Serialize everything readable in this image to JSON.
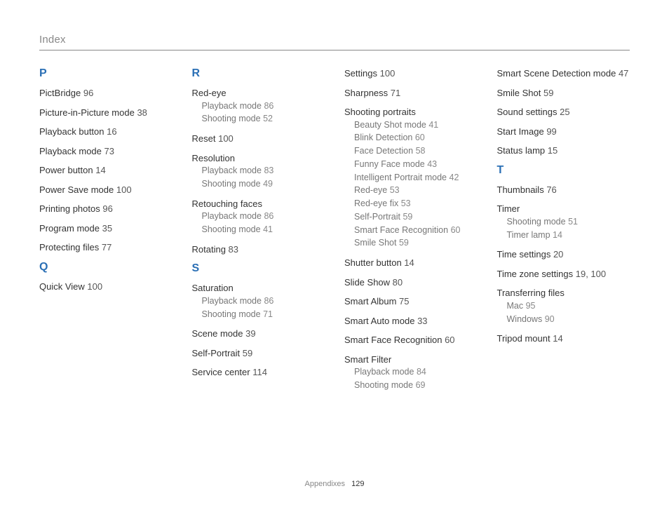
{
  "header": "Index",
  "footer_label": "Appendixes",
  "footer_page": "129",
  "columns": [
    {
      "sections": [
        {
          "letter": "P",
          "entries": [
            {
              "title": "PictBridge",
              "page": "96"
            },
            {
              "title": "Picture-in-Picture mode",
              "page": "38"
            },
            {
              "title": "Playback button",
              "page": "16"
            },
            {
              "title": "Playback mode",
              "page": "73"
            },
            {
              "title": "Power button",
              "page": "14"
            },
            {
              "title": "Power Save mode",
              "page": "100"
            },
            {
              "title": "Printing photos",
              "page": "96"
            },
            {
              "title": "Program mode",
              "page": "35"
            },
            {
              "title": "Protecting files",
              "page": "77"
            }
          ]
        },
        {
          "letter": "Q",
          "entries": [
            {
              "title": "Quick View",
              "page": "100"
            }
          ]
        }
      ]
    },
    {
      "sections": [
        {
          "letter": "R",
          "entries": [
            {
              "title": "Red-eye",
              "subs": [
                {
                  "title": "Playback mode",
                  "page": "86"
                },
                {
                  "title": "Shooting mode",
                  "page": "52"
                }
              ]
            },
            {
              "title": "Reset",
              "page": "100"
            },
            {
              "title": "Resolution",
              "subs": [
                {
                  "title": "Playback mode",
                  "page": "83"
                },
                {
                  "title": "Shooting mode",
                  "page": "49"
                }
              ]
            },
            {
              "title": "Retouching faces",
              "subs": [
                {
                  "title": "Playback mode",
                  "page": "86"
                },
                {
                  "title": "Shooting mode",
                  "page": "41"
                }
              ]
            },
            {
              "title": "Rotating",
              "page": "83"
            }
          ]
        },
        {
          "letter": "S",
          "entries": [
            {
              "title": "Saturation",
              "subs": [
                {
                  "title": "Playback mode",
                  "page": "86"
                },
                {
                  "title": "Shooting mode",
                  "page": "71"
                }
              ]
            },
            {
              "title": "Scene mode",
              "page": "39"
            },
            {
              "title": "Self-Portrait",
              "page": "59"
            },
            {
              "title": "Service center",
              "page": "114"
            }
          ]
        }
      ]
    },
    {
      "sections": [
        {
          "entries": [
            {
              "title": "Settings",
              "page": "100"
            },
            {
              "title": "Sharpness",
              "page": "71"
            },
            {
              "title": "Shooting portraits",
              "subs": [
                {
                  "title": "Beauty Shot mode",
                  "page": "41"
                },
                {
                  "title": "Blink Detection",
                  "page": "60"
                },
                {
                  "title": "Face Detection",
                  "page": "58"
                },
                {
                  "title": "Funny Face mode",
                  "page": "43"
                },
                {
                  "title": "Intelligent Portrait mode",
                  "page": "42"
                },
                {
                  "title": "Red-eye",
                  "page": "53"
                },
                {
                  "title": "Red-eye fix",
                  "page": "53"
                },
                {
                  "title": "Self-Portrait",
                  "page": "59"
                },
                {
                  "title": "Smart Face Recognition",
                  "page": "60"
                },
                {
                  "title": "Smile Shot",
                  "page": "59"
                }
              ]
            },
            {
              "title": "Shutter button",
              "page": "14"
            },
            {
              "title": "Slide Show",
              "page": "80"
            },
            {
              "title": "Smart Album",
              "page": "75"
            },
            {
              "title": "Smart Auto mode",
              "page": "33"
            },
            {
              "title": "Smart Face Recognition",
              "page": "60"
            },
            {
              "title": "Smart Filter",
              "subs": [
                {
                  "title": "Playback mode",
                  "page": "84"
                },
                {
                  "title": "Shooting mode",
                  "page": "69"
                }
              ]
            }
          ]
        }
      ]
    },
    {
      "sections": [
        {
          "entries": [
            {
              "title": "Smart Scene Detection mode",
              "page": "47"
            },
            {
              "title": "Smile Shot",
              "page": "59"
            },
            {
              "title": "Sound settings",
              "page": "25"
            },
            {
              "title": "Start Image",
              "page": "99"
            },
            {
              "title": "Status lamp",
              "page": "15"
            }
          ]
        },
        {
          "letter": "T",
          "entries": [
            {
              "title": "Thumbnails",
              "page": "76"
            },
            {
              "title": "Timer",
              "subs": [
                {
                  "title": "Shooting mode",
                  "page": "51"
                },
                {
                  "title": "Timer lamp",
                  "page": "14"
                }
              ]
            },
            {
              "title": "Time settings",
              "page": "20"
            },
            {
              "title": "Time zone settings",
              "page": "19, 100"
            },
            {
              "title": "Transferring files",
              "subs": [
                {
                  "title": "Mac",
                  "page": "95"
                },
                {
                  "title": "Windows",
                  "page": "90"
                }
              ]
            },
            {
              "title": "Tripod mount",
              "page": "14"
            }
          ]
        }
      ]
    }
  ]
}
